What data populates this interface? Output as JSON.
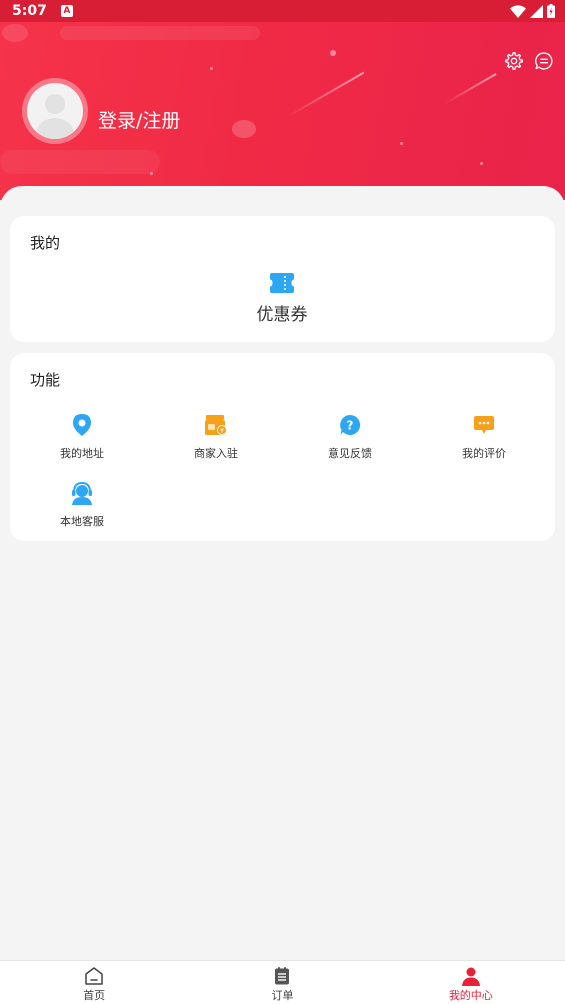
{
  "status_bar": {
    "time": "5:07",
    "notification_badge": "A"
  },
  "header": {
    "login_label": "登录/注册"
  },
  "mine_card": {
    "title": "我的",
    "items": [
      {
        "label": "优惠券",
        "icon": "coupon-icon"
      }
    ]
  },
  "function_card": {
    "title": "功能",
    "items": [
      {
        "label": "我的地址",
        "icon": "location-pin-icon"
      },
      {
        "label": "商家入驻",
        "icon": "merchant-store-icon"
      },
      {
        "label": "意见反馈",
        "icon": "question-icon"
      },
      {
        "label": "我的评价",
        "icon": "chat-bubble-icon"
      },
      {
        "label": "本地客服",
        "icon": "customer-service-icon"
      }
    ]
  },
  "bottom_nav": {
    "items": [
      {
        "label": "首页",
        "icon": "home-icon"
      },
      {
        "label": "订单",
        "icon": "order-list-icon"
      },
      {
        "label": "我的中心",
        "icon": "profile-icon",
        "active": true
      }
    ]
  },
  "colors": {
    "brand_red": "#f02a45",
    "status_bar": "#d81e34",
    "active_nav": "#e8203a",
    "icon_blue": "#2ea7f2",
    "icon_orange": "#f7a11a"
  }
}
